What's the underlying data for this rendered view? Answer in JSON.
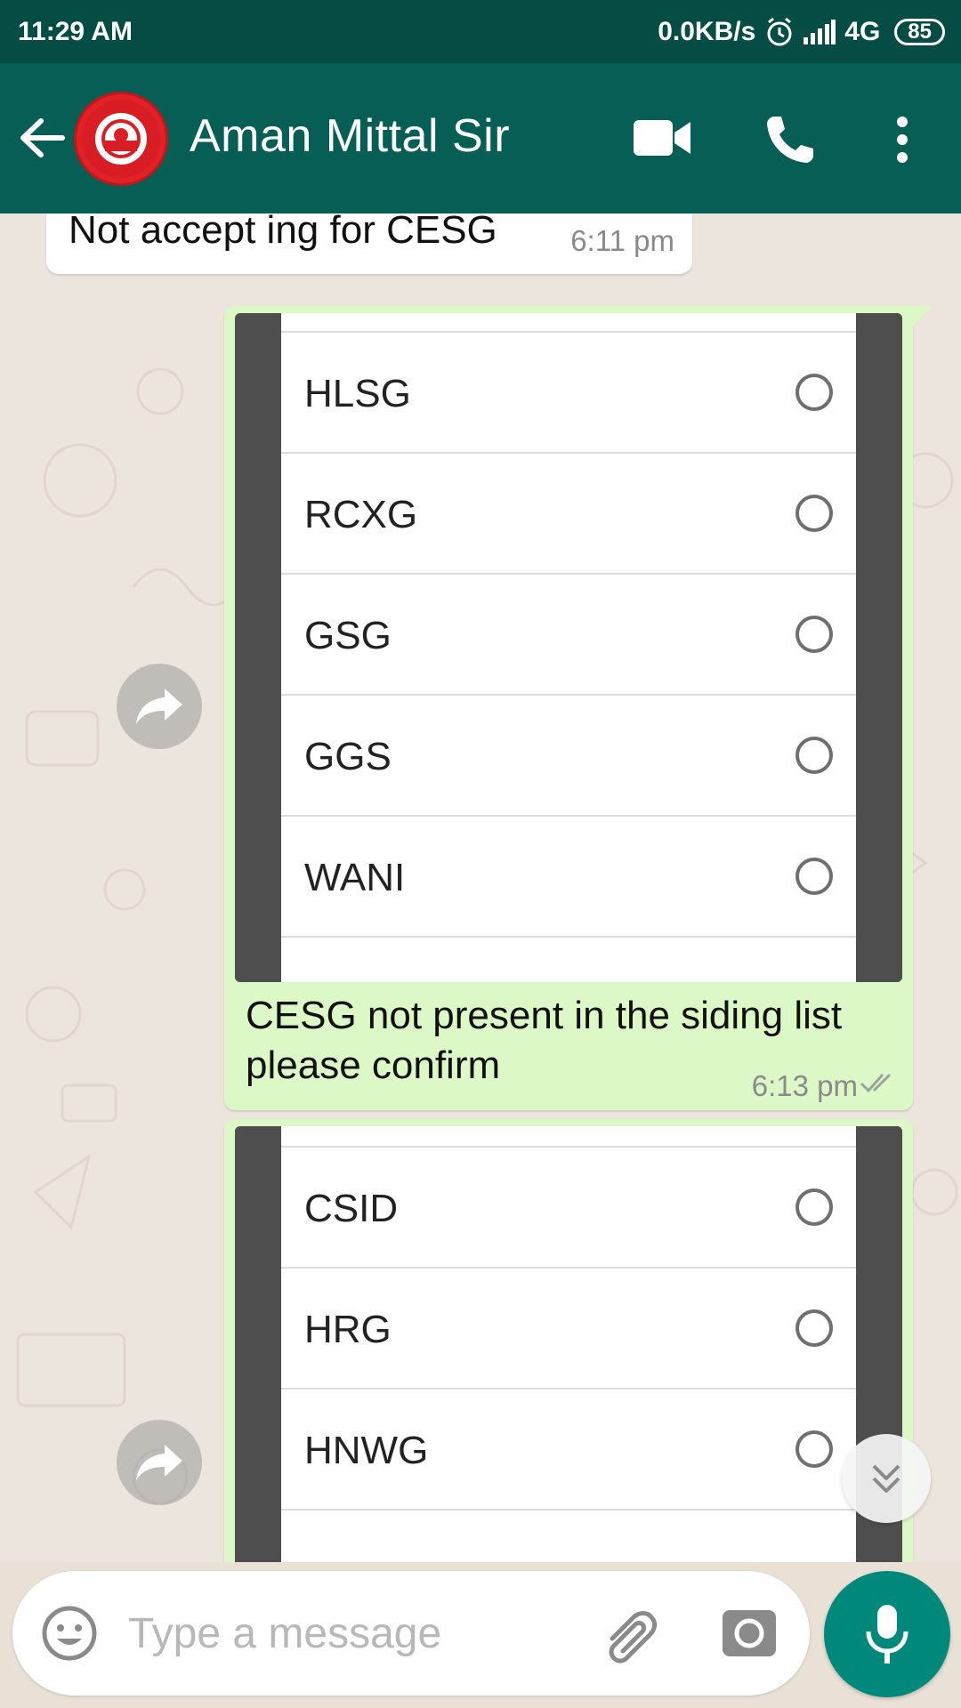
{
  "status_bar": {
    "time": "11:29 AM",
    "speed": "0.0KB/s",
    "network": "4G",
    "battery": "85"
  },
  "header": {
    "contact_name": "Aman Mittal Sir",
    "avatar_text": "INDIAN RAILWAYS"
  },
  "messages": {
    "incoming": {
      "text": "Not accept ing for CESG",
      "time": "6:11 pm"
    },
    "outgoing_1": {
      "items": [
        "HLSG",
        "RCXG",
        "GSG",
        "GGS",
        "WANI"
      ],
      "caption_line1": "CESG not present in the siding list",
      "caption_line2": "please confirm",
      "time": "6:13 pm"
    },
    "outgoing_2": {
      "items": [
        "CSID",
        "HRG",
        "HNWG"
      ]
    }
  },
  "composer": {
    "placeholder": "Type a message"
  },
  "colors": {
    "header": "#075e54",
    "status_bar": "#054c44",
    "outgoing_bubble": "#dcf8c6",
    "accent": "#00897b"
  }
}
